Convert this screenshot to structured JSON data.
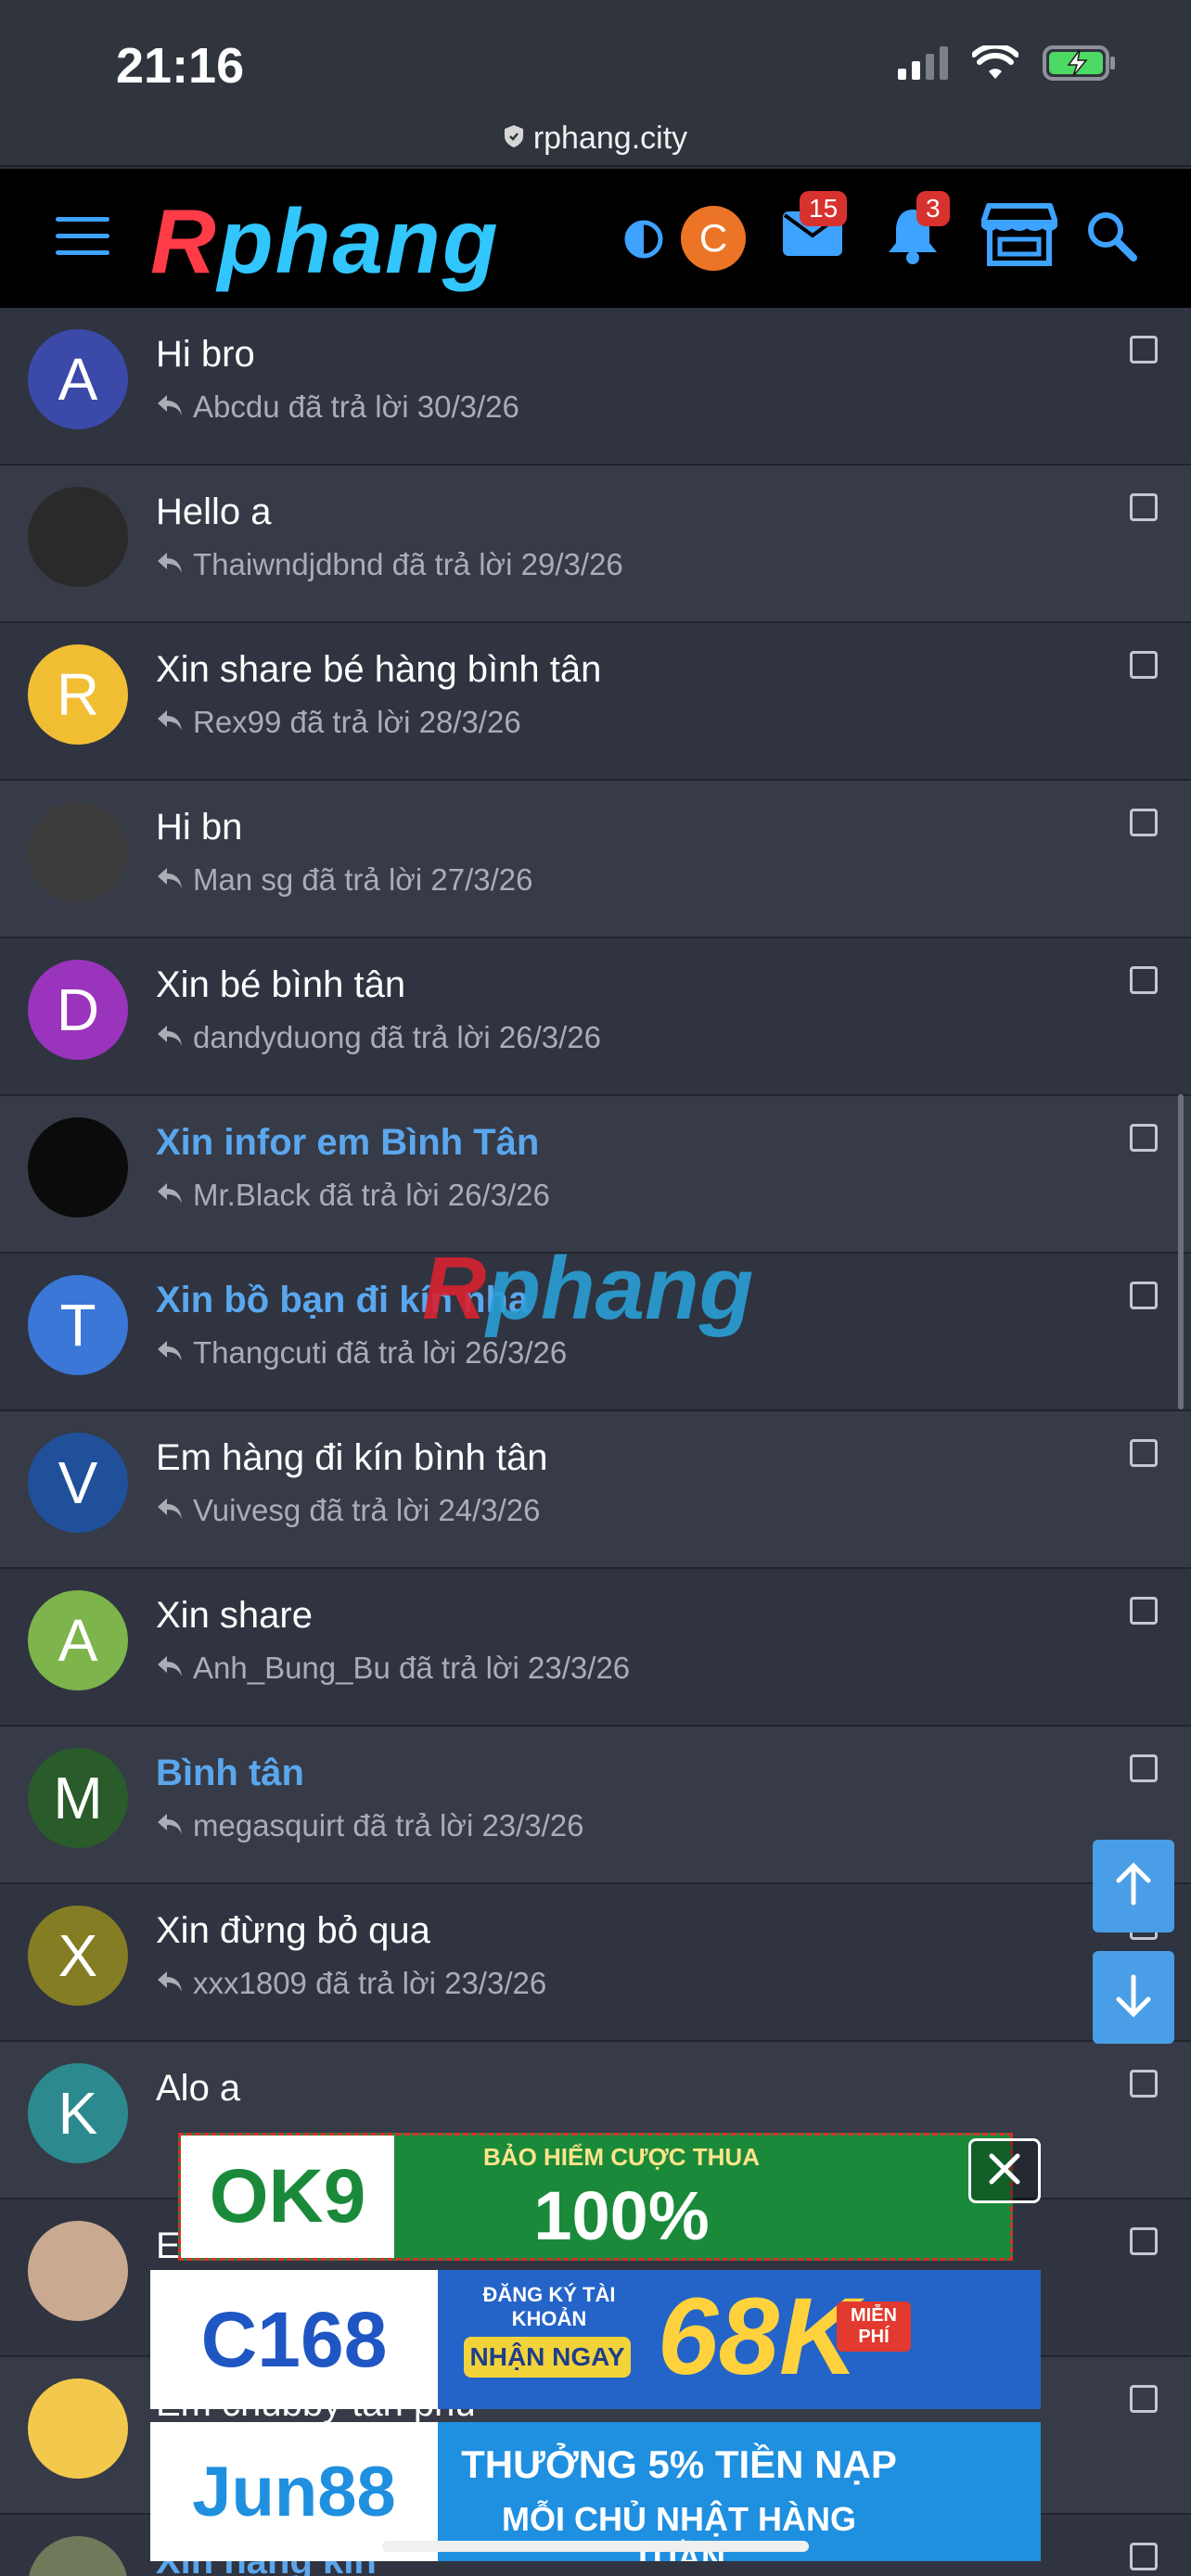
{
  "status": {
    "time": "21:16"
  },
  "url": "rphang.city",
  "header": {
    "logo_r": "R",
    "logo_rest": "phang",
    "avatar_letter": "C",
    "messages_badge": "15",
    "alerts_badge": "3"
  },
  "conversations": [
    {
      "title": "Hi bro",
      "meta": "Abcdu đã trả lời 30/3/26",
      "avatar": "A",
      "avatar_color": "#3b49a8",
      "unread": false
    },
    {
      "title": "Hello a",
      "meta": "Thaiwndjdbnd đã trả lời 29/3/26",
      "avatar": "",
      "avatar_color": "#2a2a2a",
      "unread": false
    },
    {
      "title": "Xin share bé hàng bình tân",
      "meta": "Rex99 đã trả lời 28/3/26",
      "avatar": "R",
      "avatar_color": "#f1be33",
      "unread": false
    },
    {
      "title": "Hi bn",
      "meta": "Man sg đã trả lời 27/3/26",
      "avatar": "",
      "avatar_color": "#3c3c3c",
      "unread": false
    },
    {
      "title": "Xin bé bình tân",
      "meta": "dandyduong đã trả lời 26/3/26",
      "avatar": "D",
      "avatar_color": "#9a34bd",
      "unread": false
    },
    {
      "title": "Xin infor em Bình Tân",
      "meta": "Mr.Black đã trả lời 26/3/26",
      "avatar": "",
      "avatar_color": "#0b0b0b",
      "unread": true
    },
    {
      "title": "Xin bồ bạn đi kín nha",
      "meta": "Thangcuti đã trả lời 26/3/26",
      "avatar": "T",
      "avatar_color": "#3a77d6",
      "unread": true
    },
    {
      "title": "Em hàng đi kín bình tân",
      "meta": "Vuivesg đã trả lời 24/3/26",
      "avatar": "V",
      "avatar_color": "#21509a",
      "unread": false
    },
    {
      "title": "Xin share",
      "meta": "Anh_Bung_Bu đã trả lời 23/3/26",
      "avatar": "A",
      "avatar_color": "#7db44b",
      "unread": false
    },
    {
      "title": "Bình tân",
      "meta": "megasquirt đã trả lời 23/3/26",
      "avatar": "M",
      "avatar_color": "#2a5b2a",
      "unread": true
    },
    {
      "title": "Xin đừng bỏ qua",
      "meta": "xxx1809 đã trả lời 23/3/26",
      "avatar": "X",
      "avatar_color": "#857d23",
      "unread": false
    },
    {
      "title": "Alo a",
      "meta": "",
      "avatar": "K",
      "avatar_color": "#2c8a8f",
      "unread": false
    },
    {
      "title": "E",
      "meta": "",
      "avatar": "",
      "avatar_color": "#c9a98f",
      "unread": false
    },
    {
      "title": "Em chubby tân phú",
      "meta": "",
      "avatar": "",
      "avatar_color": "#f2c94c",
      "unread": false
    },
    {
      "title": "Xin hàng kín",
      "meta": "",
      "avatar": "",
      "avatar_color": "#6e7a5a",
      "unread": true
    }
  ],
  "watermark": {
    "r": "R",
    "rest": "phang"
  },
  "ads": {
    "ok9_brand": "OK9",
    "ok9_line1": "BẢO HIỂM CƯỢC THUA",
    "ok9_line2": "100%",
    "c168_brand": "C168",
    "c168_line1": "ĐĂNG KÝ TÀI KHOẢN",
    "c168_line2": "NHẬN NGAY",
    "c168_amount": "68K",
    "c168_tag": "MIỄN PHÍ",
    "jun_brand": "Jun88",
    "jun_line1": "THƯỞNG 5% TIỀN NẠP",
    "jun_line2": "MỖI CHỦ NHẬT HÀNG TUẦN"
  }
}
